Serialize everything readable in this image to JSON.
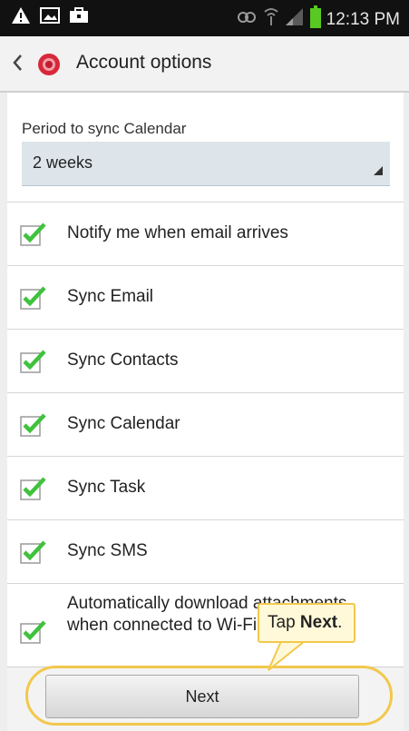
{
  "status_bar": {
    "time": "12:13 PM",
    "icons": [
      "warning-icon",
      "image-icon",
      "briefcase-icon",
      "sync-icon",
      "wifi-icon",
      "signal-icon",
      "battery-icon"
    ]
  },
  "action_bar": {
    "back_icon": "chevron-left-icon",
    "app_icon": "email-app-icon",
    "title": "Account options"
  },
  "calendar_sync": {
    "label": "Period to sync Calendar",
    "value": "2 weeks"
  },
  "options": [
    {
      "label": "Notify me when email arrives",
      "checked": true
    },
    {
      "label": "Sync Email",
      "checked": true
    },
    {
      "label": "Sync Contacts",
      "checked": true
    },
    {
      "label": "Sync Calendar",
      "checked": true
    },
    {
      "label": "Sync Task",
      "checked": true
    },
    {
      "label": "Sync SMS",
      "checked": true
    },
    {
      "label": "Automatically download attachments when connected to Wi-Fi",
      "checked": true
    }
  ],
  "next_button": {
    "label": "Next"
  },
  "callout": {
    "prefix": "Tap ",
    "bold": "Next",
    "suffix": "."
  },
  "colors": {
    "checkmark": "#3fc23c",
    "highlight": "#f2c84b",
    "callout_bg": "#fff9d9",
    "dropdown_bg": "#dde5ea",
    "status_bar": "#111111",
    "battery": "#57c922"
  }
}
